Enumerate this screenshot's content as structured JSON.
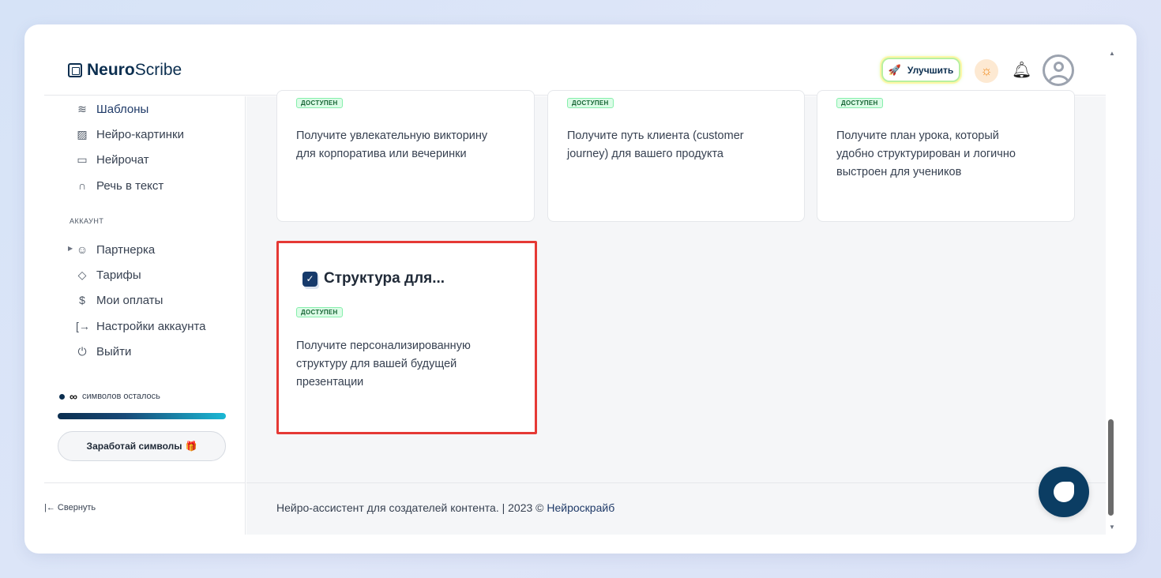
{
  "header": {
    "brand_bold": "Neuro",
    "brand_light": "Scribe",
    "upgrade_label": "Улучшить"
  },
  "sidebar": {
    "items_top": [
      {
        "label": "Шаблоны",
        "icon": "layers-icon"
      },
      {
        "label": "Нейро-картинки",
        "icon": "image-icon"
      },
      {
        "label": "Нейрочат",
        "icon": "chat-icon"
      },
      {
        "label": "Речь в текст",
        "icon": "headphones-icon"
      }
    ],
    "section_account": "АККАУНТ",
    "items_account": [
      {
        "label": "Партнерка",
        "icon": "users-icon"
      },
      {
        "label": "Тарифы",
        "icon": "tag-icon"
      },
      {
        "label": "Мои оплаты",
        "icon": "dollar-icon"
      },
      {
        "label": "Настройки аккаунта",
        "icon": "login-icon"
      },
      {
        "label": "Выйти",
        "icon": "power-icon"
      }
    ],
    "credits_value": "∞",
    "credits_text": "символов осталось",
    "earn_label": "Заработай символы",
    "collapse_label": "Свернуть"
  },
  "cards": [
    {
      "badge": "ДОСТУПЕН",
      "description_lines": [
        "Получите увлекательную викторину",
        "для корпоратива или вечеринки"
      ]
    },
    {
      "badge": "ДОСТУПЕН",
      "description_lines": [
        "Получите путь клиента (customer",
        "journey) для вашего продукта"
      ]
    },
    {
      "badge": "ДОСТУПЕН",
      "description_lines": [
        "Получите план урока, который",
        "удобно структурирован и логично",
        "выстроен для учеников"
      ]
    },
    {
      "title": "Структура для...",
      "badge": "ДОСТУПЕН",
      "description_lines": [
        "Получите персонализированную",
        "структуру для вашей будущей",
        "презентации"
      ]
    }
  ],
  "footer": {
    "text": "Нейро-ассистент для создателей контента.  | 2023 © ",
    "link": "Нейроскрайб"
  },
  "colors": {
    "brand_navy": "#0b2e4f",
    "highlight_border": "#e53935",
    "badge_green": "#dcfce7"
  }
}
